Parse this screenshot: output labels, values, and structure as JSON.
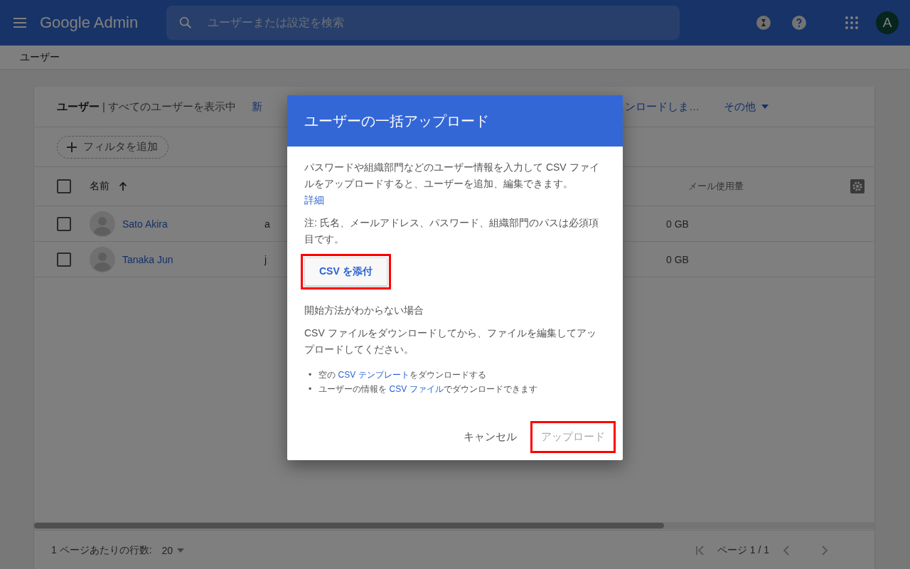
{
  "app_bar": {
    "product": "Google Admin",
    "search": {
      "placeholder": "ユーザーまたは設定を検索"
    },
    "avatar": "A"
  },
  "breadcrumb": "ユーザー",
  "users_panel": {
    "title": "ユーザー",
    "subtitle": "| すべてのユーザーを表示中",
    "actions": [
      {
        "label": "新",
        "dropdown": false
      },
      {
        "label": "ンロードしま…",
        "dropdown": false
      },
      {
        "label": "その他",
        "dropdown": true
      }
    ],
    "filter_button": "フィルタを追加",
    "table": {
      "columns": [
        {
          "label": "名前",
          "sorted": true
        },
        {
          "label": "メール使用量",
          "sorted": false
        }
      ],
      "all_checked": false,
      "rows": [
        {
          "name": "Sato Akira",
          "email": "a",
          "mail_usage": "0 GB",
          "checked": false
        },
        {
          "name": "Tanaka Jun",
          "email": "j",
          "mail_usage": "0 GB",
          "checked": false
        }
      ]
    },
    "footer": {
      "rows_per_page_label": "1 ページあたりの行数:",
      "rows_per_page": "20",
      "page": "ページ 1 / 1"
    }
  },
  "dialog": {
    "title": "ユーザーの一括アップロード",
    "description": "パスワードや組織部門などのユーザー情報を入力して CSV ファイルをアップロードすると、ユーザーを追加、編集できます。",
    "link": "詳細",
    "note": "注: 氏名、メールアドレス、パスワード、組織部門のパスは必須項目です。",
    "attach_button": {
      "label": "CSV を添付",
      "highlighted": true
    },
    "help_heading": "開始方法がわからない場合",
    "help_text": "CSV ファイルをダウンロードしてから、ファイルを編集してアップロードしてください。",
    "bullets": [
      {
        "marker": "•",
        "before": "空の ",
        "link": "CSV テンプレート",
        "after": "をダウンロードする"
      },
      {
        "marker": "•",
        "before": "ユーザーの情報を ",
        "link": "CSV ファイル",
        "after": "でダウンロードできます"
      }
    ],
    "buttons": [
      {
        "label": "キャンセル",
        "disabled": false,
        "highlighted": false
      },
      {
        "label": "アップロード",
        "disabled": true,
        "highlighted": true
      }
    ]
  }
}
